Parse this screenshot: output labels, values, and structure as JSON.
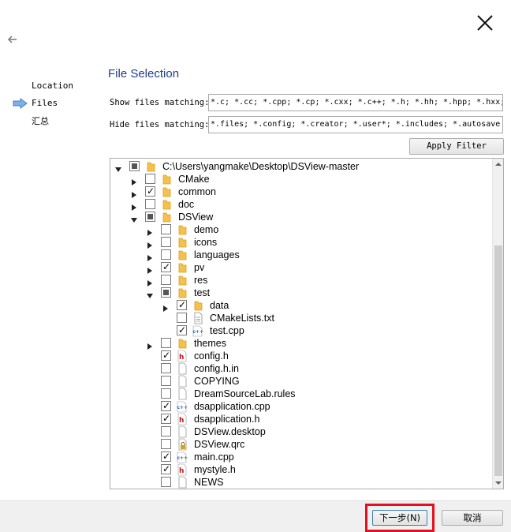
{
  "steps": [
    {
      "label": "Location",
      "current": false
    },
    {
      "label": "Files",
      "current": true
    },
    {
      "label": "汇总",
      "current": false
    }
  ],
  "page_title": "File Selection",
  "show_filter": {
    "label": "Show files matching:",
    "value": "*.c; *.cc; *.cpp; *.cp; *.cxx; *.c++; *.h; *.hh; *.hpp; *.hxx;"
  },
  "hide_filter": {
    "label": "Hide files matching:",
    "value": "*.files; *.config; *.creator; *.user*; *.includes; *.autosave"
  },
  "apply_filter_label": "Apply Filter",
  "tree": [
    {
      "label": "C:\\Users\\yangmake\\Desktop\\DSView-master",
      "depth": 0,
      "toggle": "expanded",
      "check": "partial",
      "icon": "folder-icon"
    },
    {
      "label": "CMake",
      "depth": 1,
      "toggle": "collapsed",
      "check": "unchecked",
      "icon": "folder-icon"
    },
    {
      "label": "common",
      "depth": 1,
      "toggle": "collapsed",
      "check": "checked",
      "icon": "folder-icon"
    },
    {
      "label": "doc",
      "depth": 1,
      "toggle": "collapsed",
      "check": "unchecked",
      "icon": "folder-icon"
    },
    {
      "label": "DSView",
      "depth": 1,
      "toggle": "expanded",
      "check": "partial",
      "icon": "folder-icon"
    },
    {
      "label": "demo",
      "depth": 2,
      "toggle": "collapsed",
      "check": "unchecked",
      "icon": "folder-icon"
    },
    {
      "label": "icons",
      "depth": 2,
      "toggle": "collapsed",
      "check": "unchecked",
      "icon": "folder-icon"
    },
    {
      "label": "languages",
      "depth": 2,
      "toggle": "collapsed",
      "check": "unchecked",
      "icon": "folder-icon"
    },
    {
      "label": "pv",
      "depth": 2,
      "toggle": "collapsed",
      "check": "checked",
      "icon": "folder-icon"
    },
    {
      "label": "res",
      "depth": 2,
      "toggle": "collapsed",
      "check": "unchecked",
      "icon": "folder-icon"
    },
    {
      "label": "test",
      "depth": 2,
      "toggle": "expanded",
      "check": "partial",
      "icon": "folder-icon"
    },
    {
      "label": "data",
      "depth": 3,
      "toggle": "collapsed",
      "check": "checked",
      "icon": "folder-icon"
    },
    {
      "label": "CMakeLists.txt",
      "depth": 3,
      "toggle": "none",
      "check": "unchecked",
      "icon": "text-file-icon"
    },
    {
      "label": "test.cpp",
      "depth": 3,
      "toggle": "none",
      "check": "checked",
      "icon": "cpp-file-icon"
    },
    {
      "label": "themes",
      "depth": 2,
      "toggle": "collapsed",
      "check": "unchecked",
      "icon": "folder-icon"
    },
    {
      "label": "config.h",
      "depth": 2,
      "toggle": "none",
      "check": "checked",
      "icon": "header-file-icon"
    },
    {
      "label": "config.h.in",
      "depth": 2,
      "toggle": "none",
      "check": "unchecked",
      "icon": "generic-file-icon"
    },
    {
      "label": "COPYING",
      "depth": 2,
      "toggle": "none",
      "check": "unchecked",
      "icon": "generic-file-icon"
    },
    {
      "label": "DreamSourceLab.rules",
      "depth": 2,
      "toggle": "none",
      "check": "unchecked",
      "icon": "generic-file-icon"
    },
    {
      "label": "dsapplication.cpp",
      "depth": 2,
      "toggle": "none",
      "check": "checked",
      "icon": "cpp-file-icon"
    },
    {
      "label": "dsapplication.h",
      "depth": 2,
      "toggle": "none",
      "check": "checked",
      "icon": "header-file-icon"
    },
    {
      "label": "DSView.desktop",
      "depth": 2,
      "toggle": "none",
      "check": "unchecked",
      "icon": "generic-file-icon"
    },
    {
      "label": "DSView.qrc",
      "depth": 2,
      "toggle": "none",
      "check": "unchecked",
      "icon": "qrc-file-icon"
    },
    {
      "label": "main.cpp",
      "depth": 2,
      "toggle": "none",
      "check": "checked",
      "icon": "cpp-file-icon"
    },
    {
      "label": "mystyle.h",
      "depth": 2,
      "toggle": "none",
      "check": "checked",
      "icon": "header-file-icon"
    },
    {
      "label": "NEWS",
      "depth": 2,
      "toggle": "none",
      "check": "unchecked",
      "icon": "generic-file-icon"
    }
  ],
  "buttons": {
    "next_label": "下一步(N)",
    "cancel_label": "取消"
  },
  "colors": {
    "title": "#1f3d8a",
    "folder": "#f4c14a",
    "header_file": "#c4151c",
    "cpp_file": "#1c5fb5",
    "highlight": "#e5101f"
  }
}
